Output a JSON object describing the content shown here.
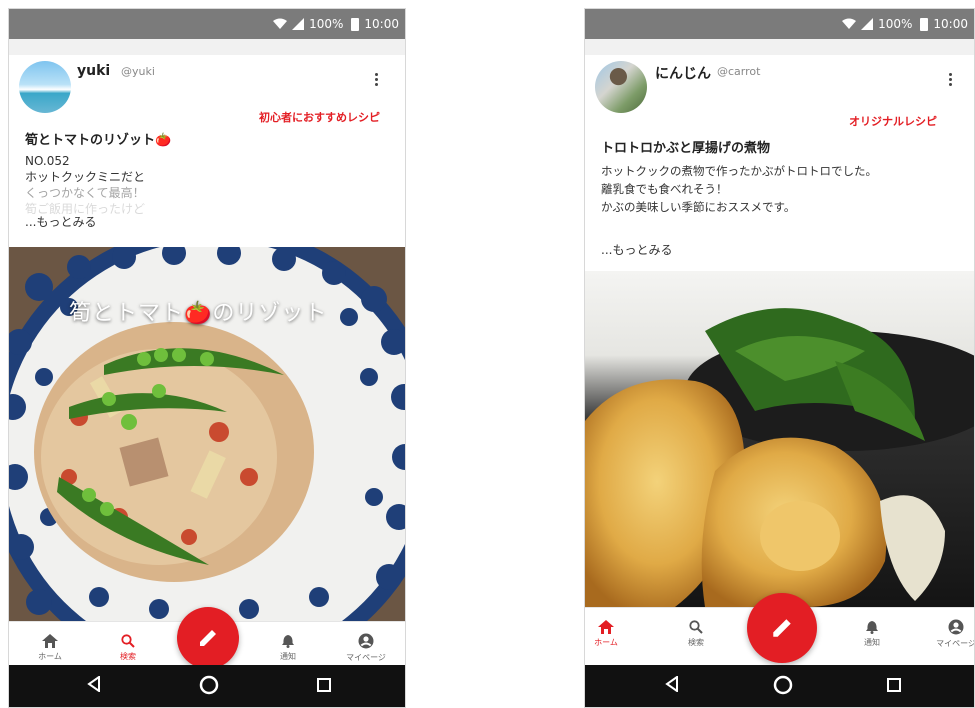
{
  "status_bar": {
    "battery": "100%",
    "time": "10:00"
  },
  "posts": [
    {
      "username": "yuki",
      "handle": "@yuki",
      "tag": "初心者におすすめレシピ",
      "tag_color": "#e31e24",
      "title": "筍とトマトのリゾット🍅",
      "lines": [
        "NO.052",
        "ホットクックミニだと",
        "くっつかなくて最高！",
        "筍ご飯用に作ったけど"
      ],
      "more": "...もっとみる",
      "photo_caption": "筍とトマト🍅のリゾット"
    },
    {
      "username": "にんじん",
      "handle": "@carrot",
      "tag": "オリジナルレシピ",
      "tag_color": "#e31e24",
      "title": "トロトロかぶと厚揚げの煮物",
      "lines": [
        "ホットクックの煮物で作ったかぶがトロトロでした。",
        "離乳食でも食べれそう！",
        "かぶの美味しい季節におススメです。"
      ],
      "more": "...もっとみる"
    }
  ],
  "tabbar": {
    "home": "ホーム",
    "search": "検索",
    "notify": "通知",
    "mypage": "マイページ"
  },
  "colors": {
    "accent": "#e31e24",
    "status_bar": "#7b7b7b",
    "nav_bar": "#111111"
  },
  "icons": [
    "wifi-icon",
    "signal-icon",
    "battery-icon",
    "home-icon",
    "search-icon",
    "pencil-icon",
    "bell-icon",
    "account-icon",
    "back-icon",
    "home-circle-icon",
    "recents-icon",
    "more-vert-icon"
  ]
}
